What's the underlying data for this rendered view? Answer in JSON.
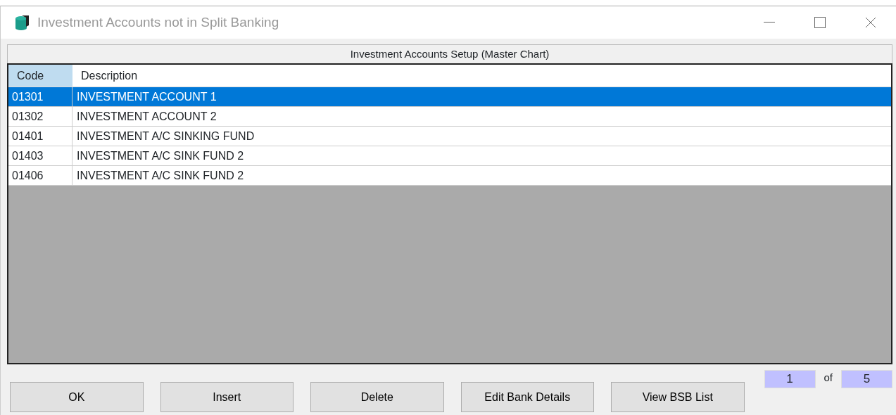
{
  "window": {
    "title": "Investment Accounts not in Split Banking"
  },
  "grid": {
    "caption": "Investment Accounts Setup (Master Chart)",
    "columns": [
      {
        "label": "Code",
        "selected": true
      },
      {
        "label": "Description",
        "selected": false
      }
    ],
    "rows": [
      {
        "code": "01301",
        "description": "INVESTMENT ACCOUNT 1",
        "selected": true
      },
      {
        "code": "01302",
        "description": "INVESTMENT ACCOUNT 2",
        "selected": false
      },
      {
        "code": "01401",
        "description": "INVESTMENT A/C SINKING FUND",
        "selected": false
      },
      {
        "code": "01403",
        "description": "INVESTMENT A/C SINK FUND 2",
        "selected": false
      },
      {
        "code": "01406",
        "description": "INVESTMENT A/C SINK FUND 2",
        "selected": false
      }
    ]
  },
  "buttons": [
    "OK",
    "Insert",
    "Delete",
    "Edit Bank Details",
    "View BSB List"
  ],
  "pager": {
    "current": "1",
    "separator": "of",
    "total": "5"
  }
}
